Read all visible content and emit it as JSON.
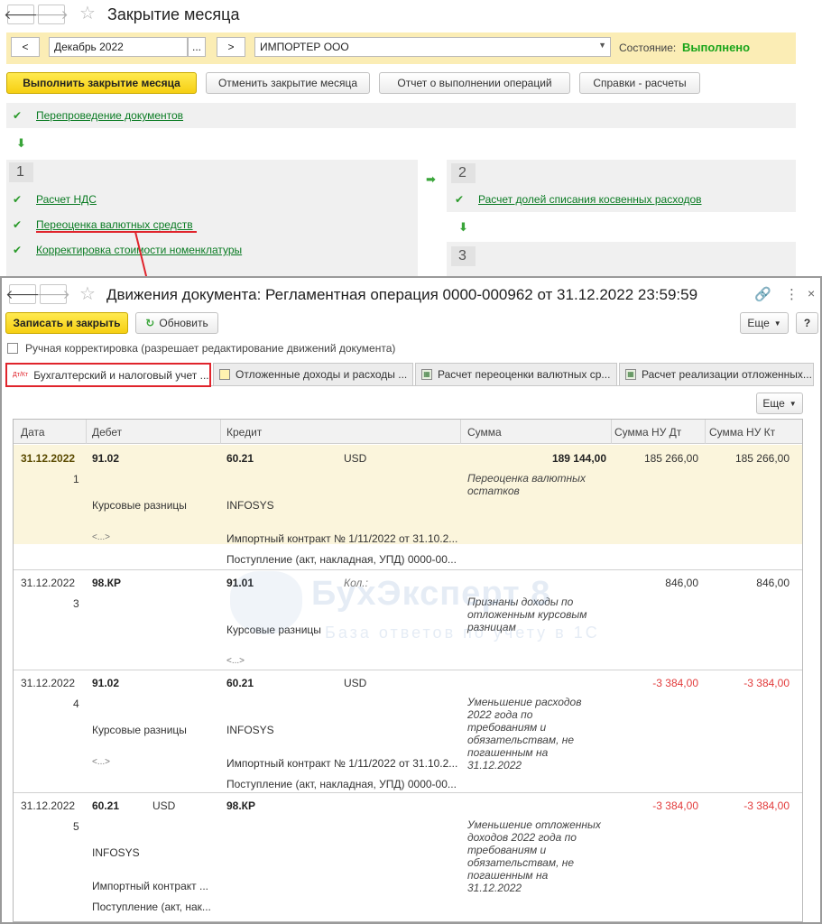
{
  "main": {
    "title": "Закрытие месяца",
    "period": "Декабрь 2022",
    "prev_label": "<",
    "next_label": ">",
    "ellipsis": "...",
    "org": "ИМПОРТЕР ООО",
    "status_label": "Состояние:",
    "status_value": "Выполнено",
    "buttons": {
      "run": "Выполнить закрытие месяца",
      "cancel": "Отменить закрытие месяца",
      "report": "Отчет о выполнении операций",
      "info": "Справки - расчеты"
    },
    "reposting": "Перепроведение документов",
    "step1": {
      "num": "1",
      "items": [
        "Расчет НДС",
        "Переоценка валютных средств",
        "Корректировка стоимости номенклатуры"
      ]
    },
    "step2": {
      "num": "2",
      "items": [
        "Расчет долей списания косвенных расходов"
      ]
    },
    "step3": {
      "num": "3"
    }
  },
  "dialog": {
    "title": "Движения документа: Регламентная операция 0000-000962 от 31.12.2022 23:59:59",
    "save_close": "Записать и закрыть",
    "refresh": "Обновить",
    "more": "Еще",
    "help": "?",
    "manual_label": "Ручная корректировка (разрешает редактирование движений документа)",
    "tabs": [
      {
        "label": "Бухгалтерский и налоговый учет ...",
        "icon": "Дт/Кт"
      },
      {
        "label": "Отложенные доходы и расходы ..."
      },
      {
        "label": "Расчет переоценки валютных ср..."
      },
      {
        "label": "Расчет реализации отложенных..."
      }
    ],
    "table_more": "Еще",
    "columns": [
      "Дата",
      "Дебет",
      "Кредит",
      "Сумма",
      "Сумма НУ Дт",
      "Сумма НУ Кт"
    ],
    "rows": [
      {
        "date": "31.12.2022",
        "num": "1",
        "debit": "91.02",
        "debit_sub": "Курсовые разницы",
        "debit_more": "<...>",
        "credit": "60.21",
        "credit_cur": "USD",
        "credit_sub1": "INFOSYS",
        "credit_sub2": "Импортный контракт № 1/11/2022 от 31.10.2...",
        "credit_sub3": "Поступление (акт, накладная, УПД) 0000-00...",
        "sum": "189 144,00",
        "desc": "Переоценка валютных остатков",
        "nu_dt": "185 266,00",
        "nu_kt": "185 266,00"
      },
      {
        "date": "31.12.2022",
        "num": "3",
        "debit": "98.КР",
        "credit": "91.01",
        "qty_label": "Кол.:",
        "credit_sub": "Курсовые разницы",
        "credit_more": "<...>",
        "desc": "Признаны доходы по отложенным курсовым разницам",
        "nu_dt": "846,00",
        "nu_kt": "846,00"
      },
      {
        "date": "31.12.2022",
        "num": "4",
        "debit": "91.02",
        "debit_sub": "Курсовые разницы",
        "debit_more": "<...>",
        "credit": "60.21",
        "credit_cur": "USD",
        "credit_sub1": "INFOSYS",
        "credit_sub2": "Импортный контракт № 1/11/2022 от 31.10.2...",
        "credit_sub3": "Поступление (акт, накладная, УПД) 0000-00...",
        "desc": "Уменьшение расходов 2022 года по требованиям и обязательствам, не погашенным на 31.12.2022",
        "nu_dt": "-3 384,00",
        "nu_kt": "-3 384,00"
      },
      {
        "date": "31.12.2022",
        "num": "5",
        "debit": "60.21",
        "debit_cur": "USD",
        "debit_sub1": "INFOSYS",
        "debit_sub2": "Импортный контракт ...",
        "debit_sub3": "Поступление (акт, нак...",
        "credit": "98.КР",
        "desc": "Уменьшение отложенных доходов 2022 года по требованиям и обязательствам, не погашенным на 31.12.2022",
        "nu_dt": "-3 384,00",
        "nu_kt": "-3 384,00"
      }
    ]
  },
  "watermark": {
    "line1": "БухЭксперт 8",
    "line2": "База ответов по учету в 1С"
  },
  "colors": {
    "link_green": "#0a7b23",
    "status_green": "#1aa51a",
    "highlight": "#e0242c",
    "negative": "#e23b3b",
    "yellow_bar": "#fbedb5"
  }
}
